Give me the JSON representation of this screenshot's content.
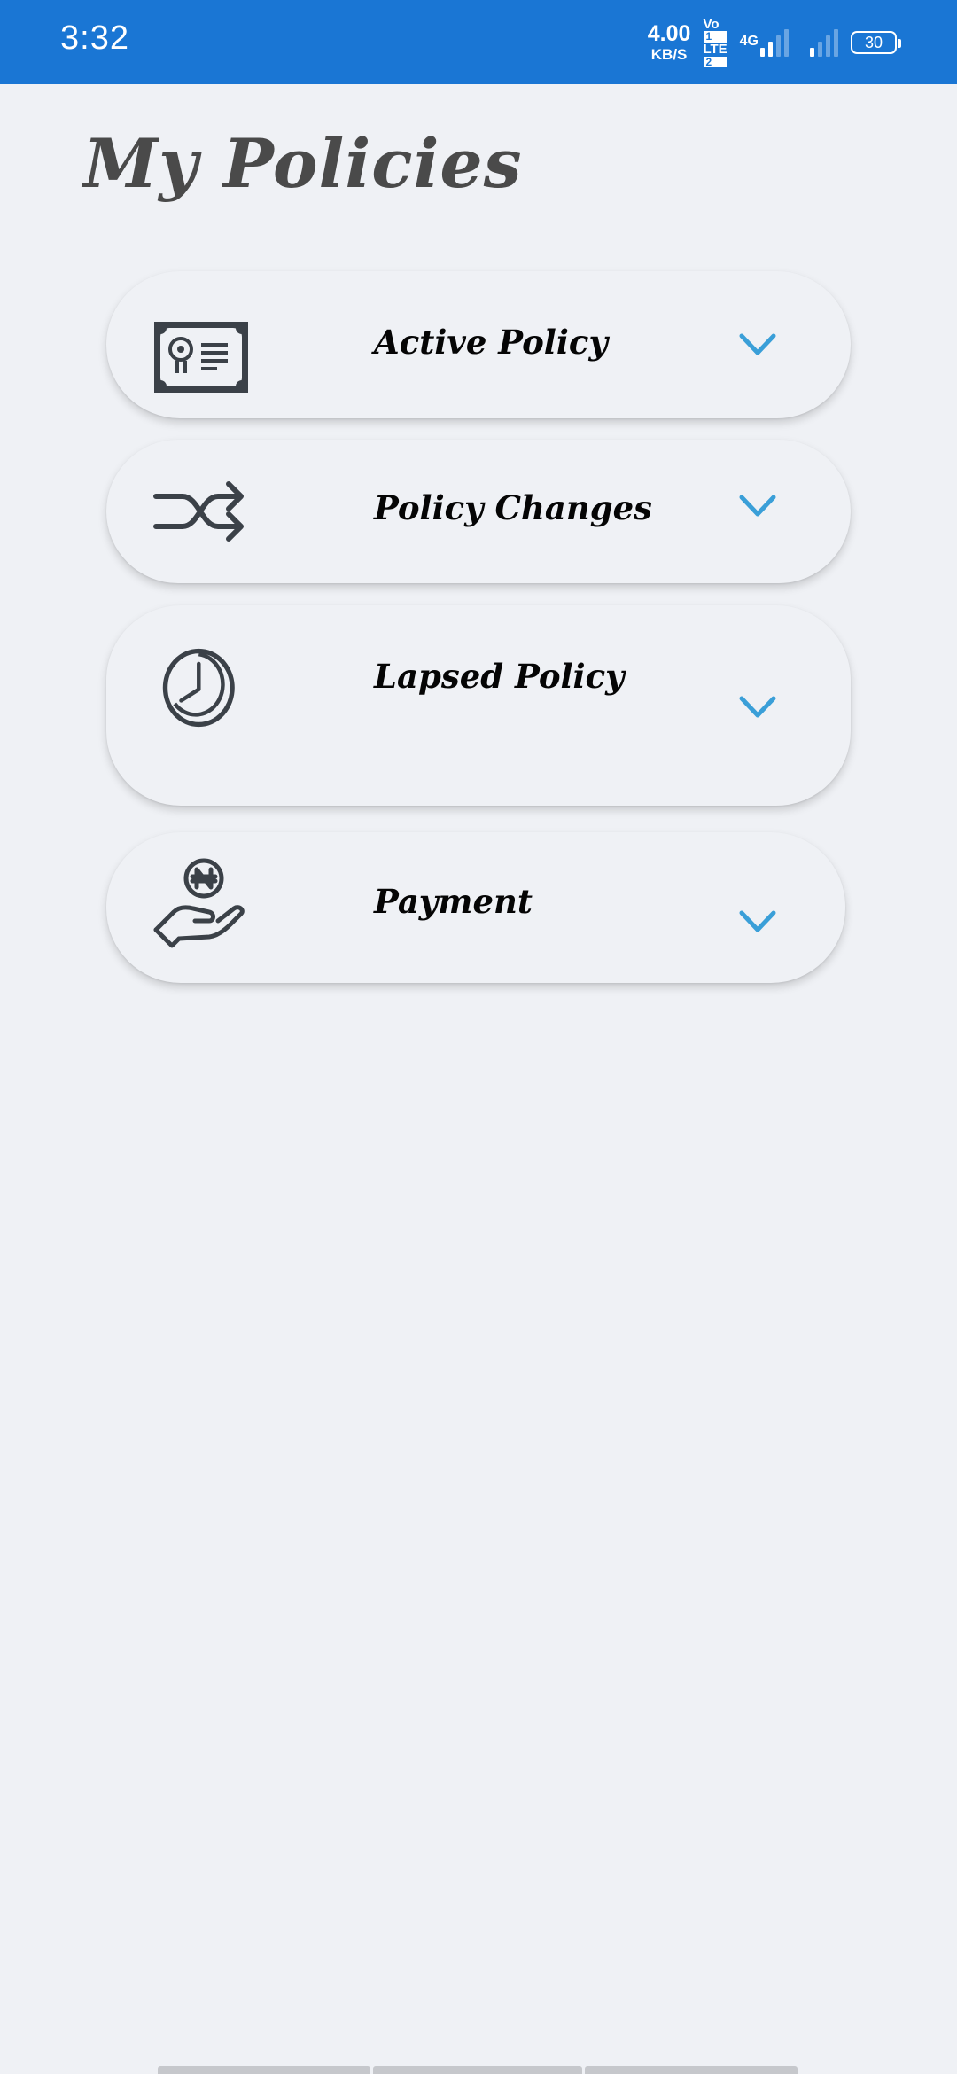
{
  "status_bar": {
    "time": "3:32",
    "net_speed_value": "4.00",
    "net_speed_unit": "KB/S",
    "volte_line1": "Vo",
    "volte_sim1": "1",
    "volte_line2": "LTE",
    "volte_sim2": "2",
    "network_type": "4G",
    "battery_level": "30",
    "icons": [
      "signal-icon",
      "signal-icon",
      "battery-icon"
    ]
  },
  "page": {
    "title": "My Policies"
  },
  "colors": {
    "status_bar_bg": "#1a76d4",
    "page_bg": "#eff1f5",
    "chevron": "#3a9fd8",
    "icon": "#3b4148",
    "title": "#4a4a4a"
  },
  "menu": {
    "items": [
      {
        "label": "Active Policy",
        "icon": "certificate-icon",
        "expand_icon": "chevron-down-icon"
      },
      {
        "label": "Policy Changes",
        "icon": "shuffle-icon",
        "expand_icon": "chevron-down-icon"
      },
      {
        "label": "Lapsed Policy",
        "icon": "clock-icon",
        "expand_icon": "chevron-down-icon"
      },
      {
        "label": "Payment",
        "icon": "hand-coin-icon",
        "expand_icon": "chevron-down-icon"
      }
    ]
  }
}
